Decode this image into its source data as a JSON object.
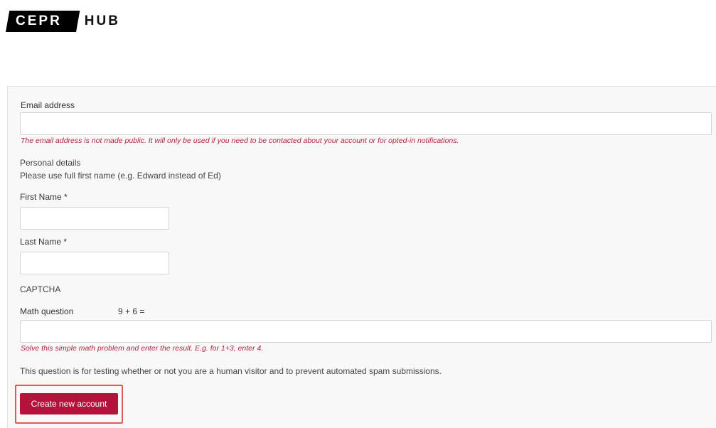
{
  "logo": {
    "part1": "CEPR",
    "part2": "HUB"
  },
  "form": {
    "email": {
      "label": "Email address",
      "value": "",
      "description": "The email address is not made public. It will only be used if you need to be contacted about your account or for opted-in notifications."
    },
    "personal": {
      "heading": "Personal details",
      "hint": "Please use full first name (e.g. Edward instead of Ed)"
    },
    "first_name": {
      "label": "First Name *",
      "value": ""
    },
    "last_name": {
      "label": "Last Name *",
      "value": ""
    },
    "captcha": {
      "heading": "CAPTCHA",
      "math_label": "Math question",
      "math_problem": "9 + 6 =",
      "value": "",
      "description": "Solve this simple math problem and enter the result. E.g. for 1+3, enter 4.",
      "explanation": "This question is for testing whether or not you are a human visitor and to prevent automated spam submissions."
    },
    "submit_label": "Create new account"
  },
  "colors": {
    "accent": "#b3123a",
    "error_text": "#b5213e",
    "highlight": "#e05a5a"
  }
}
